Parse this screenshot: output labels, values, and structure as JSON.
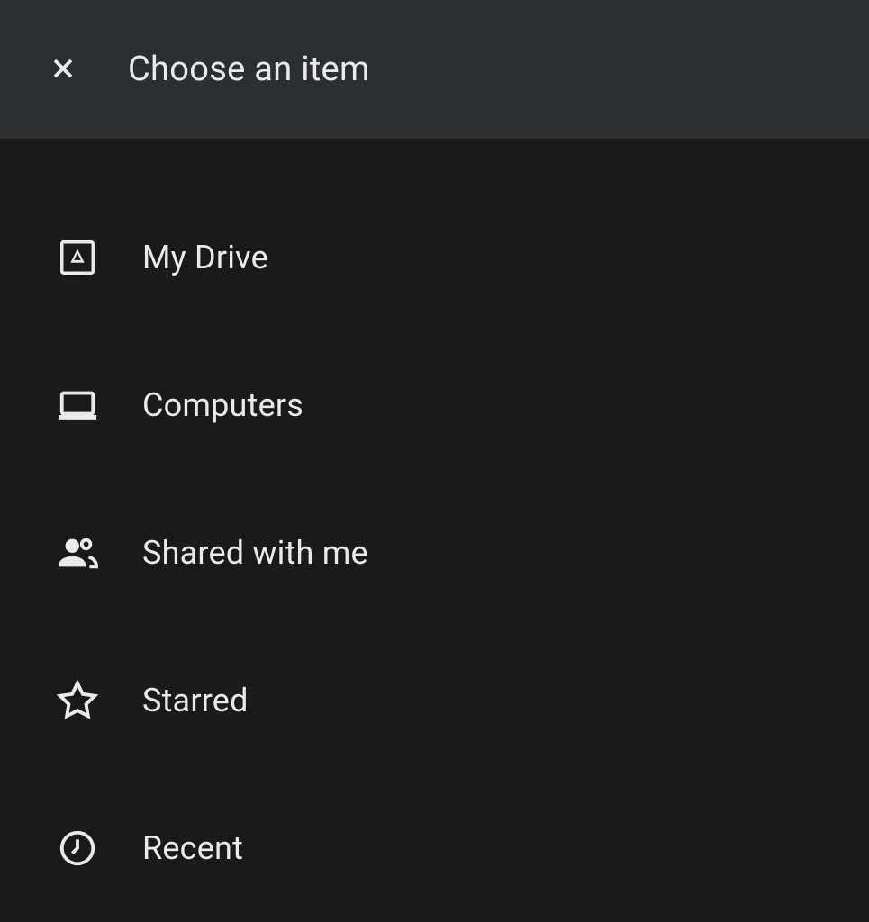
{
  "header": {
    "title": "Choose an item"
  },
  "items": [
    {
      "icon": "drive-icon",
      "label": "My Drive"
    },
    {
      "icon": "computers-icon",
      "label": "Computers"
    },
    {
      "icon": "shared-icon",
      "label": "Shared with me"
    },
    {
      "icon": "starred-icon",
      "label": "Starred"
    },
    {
      "icon": "recent-icon",
      "label": "Recent"
    }
  ]
}
